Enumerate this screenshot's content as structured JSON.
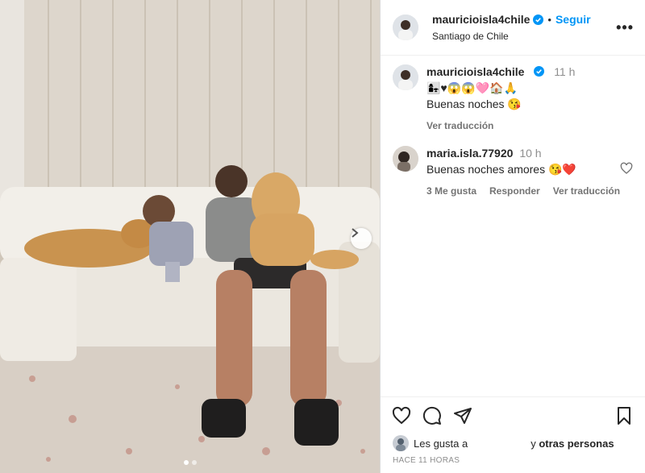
{
  "post": {
    "author": "mauricioisla4chile",
    "follow_label": "Seguir",
    "location": "Santiago de Chile",
    "more_label": "•••"
  },
  "caption": {
    "author": "mauricioisla4chile",
    "time": "11 h",
    "emojis": "👩‍👧♥😱😱🩷🏠🙏",
    "text": "Buenas noches 😘",
    "translate_label": "Ver traducción"
  },
  "comment": {
    "author": "maria.isla.77920",
    "time": "10 h",
    "text": "Buenas noches amores 😘❤️",
    "likes_label": "3 Me gusta",
    "reply_label": "Responder",
    "translate_label": "Ver traducción"
  },
  "likes": {
    "prefix": "Les gusta a",
    "suffix_y": "y",
    "others": "otras personas"
  },
  "posted_ago": "HACE 11 HORAS",
  "colors": {
    "accent": "#0095f6",
    "verified": "#0095f6",
    "heart_red": "#ed4956"
  },
  "icons": [
    "verified-icon",
    "more-icon",
    "heart-icon",
    "comment-icon",
    "share-icon",
    "bookmark-icon",
    "chevron-right-icon"
  ]
}
